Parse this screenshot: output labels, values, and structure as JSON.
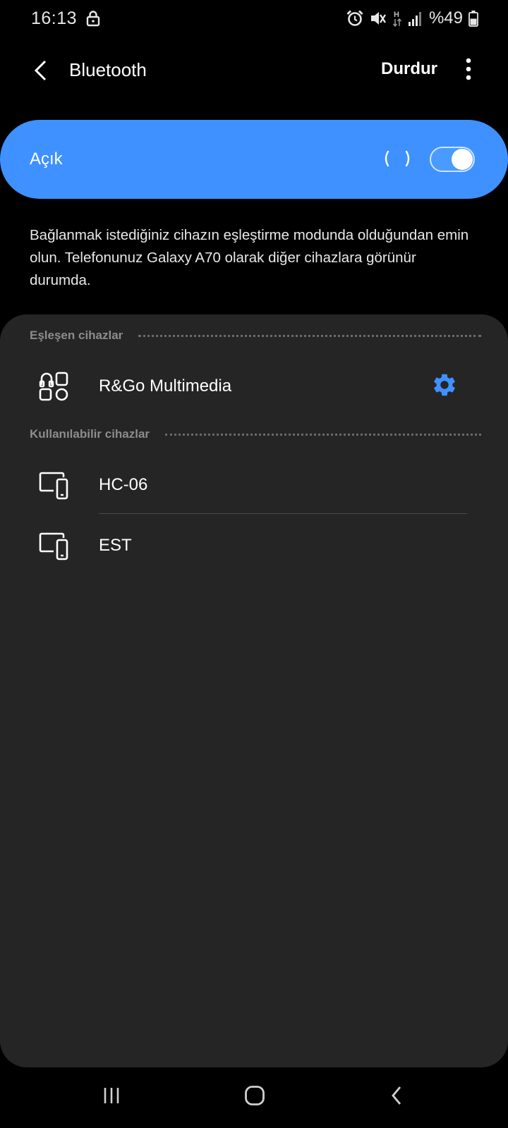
{
  "status_bar": {
    "time": "16:13",
    "battery_percent": "%49",
    "icons": [
      "lock-icon",
      "alarm-icon",
      "mute-icon",
      "hplus-data-icon",
      "signal-icon",
      "battery-icon"
    ]
  },
  "app_bar": {
    "title": "Bluetooth",
    "stop_label": "Durdur",
    "icons": [
      "back-arrow-icon",
      "more-vert-icon"
    ]
  },
  "toggle": {
    "label": "Açık",
    "state": true,
    "scanning_indicator": "spinner-icon",
    "accent_color": "#3e91ff"
  },
  "description": "Bağlanmak istediğiniz cihazın eşleştirme modunda olduğundan emin olun. Telefonunuz Galaxy A70 olarak diğer cihazlara görünür durumda.",
  "paired_section": {
    "label": "Eşleşen cihazlar",
    "devices": [
      {
        "name": "R&Go Multimedia",
        "icon": "generic-device-icon",
        "settings_icon": "gear-icon",
        "settings_color": "#3e91ff"
      }
    ]
  },
  "available_section": {
    "label": "Kullanılabilir cihazlar",
    "devices": [
      {
        "name": "HC-06",
        "icon": "phone-computer-icon"
      },
      {
        "name": "EST",
        "icon": "phone-computer-icon"
      }
    ]
  },
  "nav_bar": {
    "icons": [
      "recent-apps-icon",
      "home-icon",
      "back-icon"
    ]
  }
}
